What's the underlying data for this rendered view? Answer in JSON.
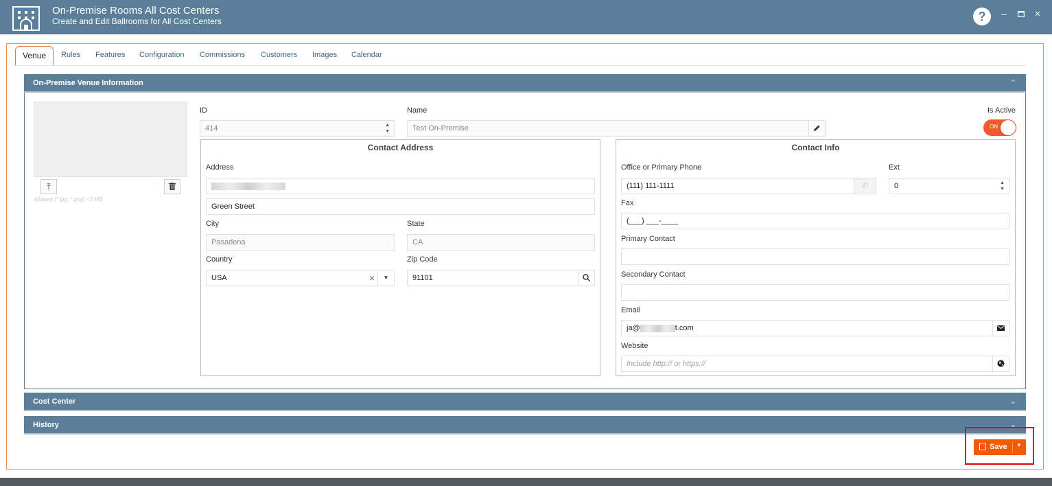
{
  "window": {
    "title": "On-Premise Rooms All Cost Centers",
    "subtitle": "Create and Edit Ballrooms for All Cost Centers",
    "help": "?",
    "minimize": "–",
    "maximize": "▫",
    "close": "×"
  },
  "tabs": [
    {
      "label": "Venue",
      "active": true
    },
    {
      "label": "Rules"
    },
    {
      "label": "Features"
    },
    {
      "label": "Configuration"
    },
    {
      "label": "Commissions"
    },
    {
      "label": "Customers"
    },
    {
      "label": "Images"
    },
    {
      "label": "Calendar"
    }
  ],
  "panels": {
    "venue_info": "On-Premise Venue Information",
    "cost_center": "Cost Center",
    "history": "History"
  },
  "photo": {
    "allowed_text": "Allowed (*.jpg, *.png) <0 MB"
  },
  "fields": {
    "id_label": "ID",
    "id_value": "414",
    "name_label": "Name",
    "name_value": "Test On-Premise",
    "is_active_label": "Is Active",
    "toggle_text": "ON"
  },
  "contact_address": {
    "title": "Contact Address",
    "address_label": "Address",
    "address_line2": "Green Street",
    "city_label": "City",
    "city_value": "Pasadena",
    "state_label": "State",
    "state_value": "CA",
    "country_label": "Country",
    "country_value": "USA",
    "zip_label": "Zip Code",
    "zip_value": "91101"
  },
  "contact_info": {
    "title": "Contact Info",
    "phone_label": "Office or Primary Phone",
    "phone_value": "(111) 111-1111",
    "ext_label": "Ext",
    "ext_value": "0",
    "fax_label": "Fax",
    "fax_value": "(___) ___-____",
    "primary_contact_label": "Primary Contact",
    "secondary_contact_label": "Secondary Contact",
    "email_label": "Email",
    "email_prefix": "ja@",
    "email_suffix": "t.com",
    "website_label": "Website",
    "website_placeholder": "Include http:// or https://"
  },
  "save": {
    "label": "Save"
  },
  "colors": {
    "header": "#5b7f99",
    "accent": "#f25a06",
    "highlight": "#e00000"
  }
}
